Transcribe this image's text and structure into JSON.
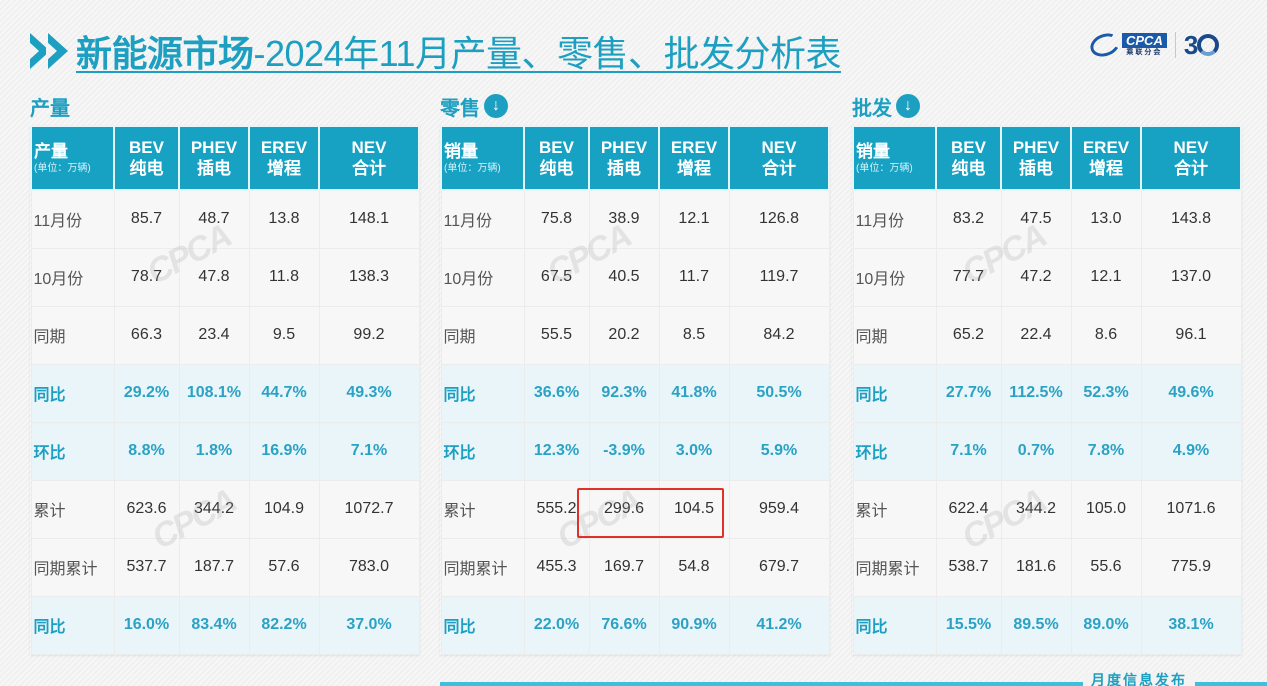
{
  "title": {
    "bold_part": "新能源市场",
    "rest": "-2024年11月产量、零售、批发分析表"
  },
  "logo": {
    "cpca": "CPCA",
    "sub": "乘联分会",
    "anniversary": "3"
  },
  "header_columns": [
    {
      "code": "BEV",
      "cn": "纯电"
    },
    {
      "code": "PHEV",
      "cn": "插电"
    },
    {
      "code": "EREV",
      "cn": "增程"
    },
    {
      "code": "NEV",
      "cn": "合计"
    }
  ],
  "unit": "(单位：万辆)",
  "sections": [
    {
      "label": "产量",
      "row_header": "产量",
      "has_icon": false,
      "rows": [
        {
          "label": "11月份",
          "type": "value",
          "values": [
            "85.7",
            "48.7",
            "13.8",
            "148.1"
          ]
        },
        {
          "label": "10月份",
          "type": "value",
          "values": [
            "78.7",
            "47.8",
            "11.8",
            "138.3"
          ]
        },
        {
          "label": "同期",
          "type": "value",
          "values": [
            "66.3",
            "23.4",
            "9.5",
            "99.2"
          ]
        },
        {
          "label": "同比",
          "type": "pct",
          "values": [
            "29.2%",
            "108.1%",
            "44.7%",
            "49.3%"
          ]
        },
        {
          "label": "环比",
          "type": "pct",
          "values": [
            "8.8%",
            "1.8%",
            "16.9%",
            "7.1%"
          ]
        },
        {
          "label": "累计",
          "type": "value",
          "values": [
            "623.6",
            "344.2",
            "104.9",
            "1072.7"
          ]
        },
        {
          "label": "同期累计",
          "type": "value",
          "values": [
            "537.7",
            "187.7",
            "57.6",
            "783.0"
          ]
        },
        {
          "label": "同比",
          "type": "pct",
          "values": [
            "16.0%",
            "83.4%",
            "82.2%",
            "37.0%"
          ]
        }
      ]
    },
    {
      "label": "零售",
      "row_header": "销量",
      "has_icon": true,
      "rows": [
        {
          "label": "11月份",
          "type": "value",
          "values": [
            "75.8",
            "38.9",
            "12.1",
            "126.8"
          ]
        },
        {
          "label": "10月份",
          "type": "value",
          "values": [
            "67.5",
            "40.5",
            "11.7",
            "119.7"
          ]
        },
        {
          "label": "同期",
          "type": "value",
          "values": [
            "55.5",
            "20.2",
            "8.5",
            "84.2"
          ]
        },
        {
          "label": "同比",
          "type": "pct",
          "values": [
            "36.6%",
            "92.3%",
            "41.8%",
            "50.5%"
          ]
        },
        {
          "label": "环比",
          "type": "pct",
          "values": [
            "12.3%",
            "-3.9%",
            "3.0%",
            "5.9%"
          ]
        },
        {
          "label": "累计",
          "type": "value",
          "values": [
            "555.2",
            "299.6",
            "104.5",
            "959.4"
          ]
        },
        {
          "label": "同期累计",
          "type": "value",
          "values": [
            "455.3",
            "169.7",
            "54.8",
            "679.7"
          ]
        },
        {
          "label": "同比",
          "type": "pct",
          "values": [
            "22.0%",
            "76.6%",
            "90.9%",
            "41.2%"
          ]
        }
      ]
    },
    {
      "label": "批发",
      "row_header": "销量",
      "has_icon": true,
      "rows": [
        {
          "label": "11月份",
          "type": "value",
          "values": [
            "83.2",
            "47.5",
            "13.0",
            "143.8"
          ]
        },
        {
          "label": "10月份",
          "type": "value",
          "values": [
            "77.7",
            "47.2",
            "12.1",
            "137.0"
          ]
        },
        {
          "label": "同期",
          "type": "value",
          "values": [
            "65.2",
            "22.4",
            "8.6",
            "96.1"
          ]
        },
        {
          "label": "同比",
          "type": "pct",
          "values": [
            "27.7%",
            "112.5%",
            "52.3%",
            "49.6%"
          ]
        },
        {
          "label": "环比",
          "type": "pct",
          "values": [
            "7.1%",
            "0.7%",
            "7.8%",
            "4.9%"
          ]
        },
        {
          "label": "累计",
          "type": "value",
          "values": [
            "622.4",
            "344.2",
            "105.0",
            "1071.6"
          ]
        },
        {
          "label": "同期累计",
          "type": "value",
          "values": [
            "538.7",
            "181.6",
            "55.6",
            "775.9"
          ]
        },
        {
          "label": "同比",
          "type": "pct",
          "values": [
            "15.5%",
            "89.5%",
            "89.0%",
            "38.1%"
          ]
        }
      ]
    }
  ],
  "highlight": {
    "section": "零售",
    "row": "累计",
    "columns": [
      "PHEV",
      "EREV"
    ],
    "color": "#e0302a"
  },
  "colors": {
    "accent": "#1c9fc1",
    "header_bg": "#17a2c3",
    "pct_text": "#2aa2c4"
  },
  "footer": {
    "text": "月度信息发布"
  }
}
